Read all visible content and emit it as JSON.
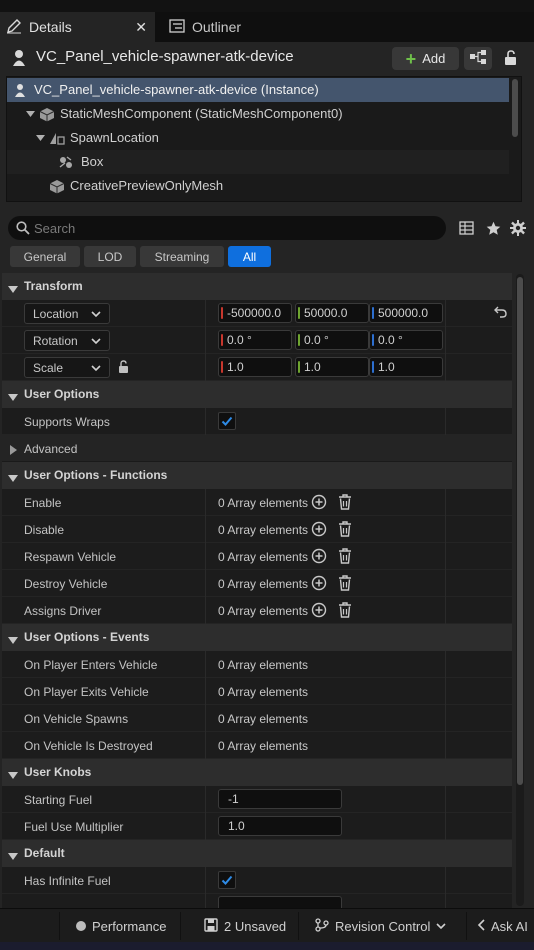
{
  "tabs": [
    {
      "label": "Details",
      "active": true,
      "icon": "pencil-icon"
    },
    {
      "label": "Outliner",
      "active": false,
      "icon": "list-icon"
    }
  ],
  "header": {
    "actor_name": "VC_Panel_vehicle-spawner-atk-device",
    "add_label": "Add"
  },
  "tree": [
    {
      "label": "VC_Panel_vehicle-spawner-atk-device (Instance)"
    },
    {
      "label": "StaticMeshComponent (StaticMeshComponent0)"
    },
    {
      "label": "SpawnLocation"
    },
    {
      "label": "Box"
    },
    {
      "label": "CreativePreviewOnlyMesh"
    }
  ],
  "search": {
    "placeholder": "Search"
  },
  "filters": [
    {
      "label": "General",
      "active": false
    },
    {
      "label": "LOD",
      "active": false
    },
    {
      "label": "Streaming",
      "active": false
    },
    {
      "label": "All",
      "active": true
    }
  ],
  "transform": {
    "title": "Transform",
    "location": {
      "label": "Location",
      "x": "-500000.0",
      "y": "50000.0",
      "z": "500000.0"
    },
    "rotation": {
      "label": "Rotation",
      "x": "0.0 °",
      "y": "0.0 °",
      "z": "0.0 °"
    },
    "scale": {
      "label": "Scale",
      "x": "1.0",
      "y": "1.0",
      "z": "1.0"
    }
  },
  "user_options": {
    "title": "User Options",
    "supports_wraps_label": "Supports Wraps",
    "supports_wraps": true,
    "advanced_label": "Advanced"
  },
  "functions": {
    "title": "User Options - Functions",
    "rows": [
      {
        "label": "Enable",
        "value": "0 Array elements"
      },
      {
        "label": "Disable",
        "value": "0 Array elements"
      },
      {
        "label": "Respawn Vehicle",
        "value": "0 Array elements"
      },
      {
        "label": "Destroy Vehicle",
        "value": "0 Array elements"
      },
      {
        "label": "Assigns Driver",
        "value": "0 Array elements"
      }
    ]
  },
  "events": {
    "title": "User Options - Events",
    "rows": [
      {
        "label": "On Player Enters Vehicle",
        "value": "0 Array elements"
      },
      {
        "label": "On Player Exits Vehicle",
        "value": "0 Array elements"
      },
      {
        "label": "On Vehicle Spawns",
        "value": "0 Array elements"
      },
      {
        "label": "On Vehicle Is Destroyed",
        "value": "0 Array elements"
      }
    ]
  },
  "knobs": {
    "title": "User Knobs",
    "starting_fuel_label": "Starting Fuel",
    "starting_fuel": "-1",
    "fuel_use_label": "Fuel Use Multiplier",
    "fuel_use": "1.0"
  },
  "default": {
    "title": "Default",
    "infinite_fuel_label": "Has Infinite Fuel",
    "infinite_fuel": true
  },
  "statusbar": {
    "performance": "Performance",
    "unsaved": "2 Unsaved",
    "revision": "Revision Control",
    "ask_ai": "Ask AI"
  },
  "colors": {
    "accent": "#0f6fde",
    "axis_x": "#c8372d",
    "axis_y": "#6fa530",
    "axis_z": "#2d6fd0",
    "add_green": "#6fc04a"
  }
}
